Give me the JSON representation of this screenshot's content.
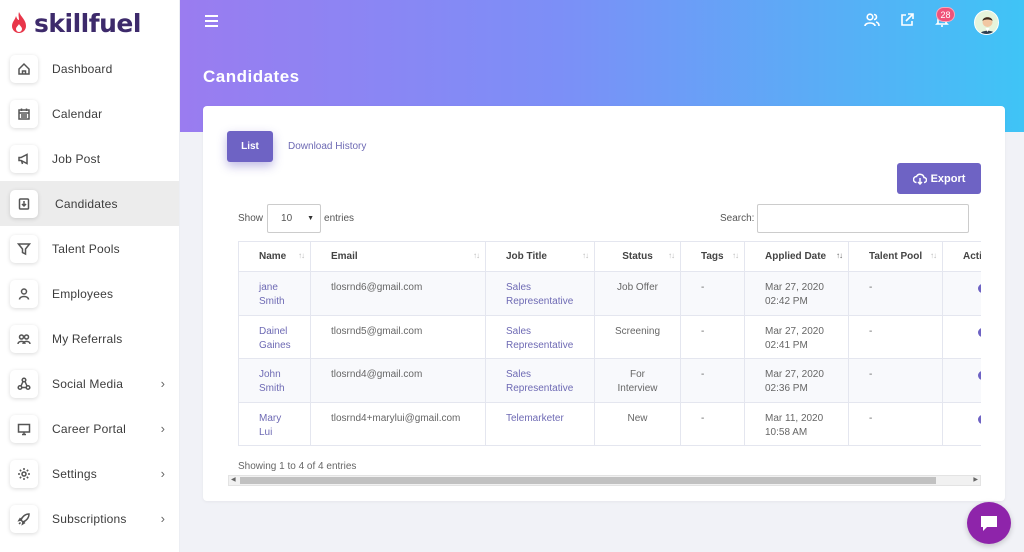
{
  "brand": {
    "name": "skillfuel"
  },
  "page": {
    "title": "Candidates"
  },
  "header": {
    "notification_count": "28"
  },
  "sidebar": {
    "items": [
      {
        "label": "Dashboard",
        "icon": "home-icon",
        "chevron": false,
        "active": false
      },
      {
        "label": "Calendar",
        "icon": "calendar-icon",
        "chevron": false,
        "active": false
      },
      {
        "label": "Job Post",
        "icon": "megaphone-icon",
        "chevron": false,
        "active": false
      },
      {
        "label": "Candidates",
        "icon": "download-box-icon",
        "chevron": false,
        "active": true
      },
      {
        "label": "Talent Pools",
        "icon": "filter-icon",
        "chevron": false,
        "active": false
      },
      {
        "label": "Employees",
        "icon": "user-icon",
        "chevron": false,
        "active": false
      },
      {
        "label": "My Referrals",
        "icon": "users-icon",
        "chevron": false,
        "active": false
      },
      {
        "label": "Social Media",
        "icon": "share-icon",
        "chevron": true,
        "active": false
      },
      {
        "label": "Career Portal",
        "icon": "monitor-icon",
        "chevron": true,
        "active": false
      },
      {
        "label": "Settings",
        "icon": "gear-icon",
        "chevron": true,
        "active": false
      },
      {
        "label": "Subscriptions",
        "icon": "rocket-icon",
        "chevron": true,
        "active": false
      }
    ]
  },
  "tabs": {
    "list": "List",
    "download_history": "Download History"
  },
  "toolbar": {
    "export_label": "Export",
    "show_label": "Show",
    "entries_value": "10",
    "entries_label": "entries",
    "search_label": "Search:",
    "search_value": ""
  },
  "table": {
    "columns": [
      "Name",
      "Email",
      "Job Title",
      "Status",
      "Tags",
      "Applied Date",
      "Talent Pool",
      "Acti"
    ],
    "rows": [
      {
        "name1": "jane",
        "name2": "Smith",
        "email": "tlosrnd6@gmail.com",
        "job1": "Sales",
        "job2": "Representative",
        "status1": "Job Offer",
        "status2": "",
        "tags": "-",
        "date1": "Mar 27, 2020",
        "date2": "02:42 PM",
        "pool": "-"
      },
      {
        "name1": "Dainel",
        "name2": "Gaines",
        "email": "tlosrnd5@gmail.com",
        "job1": "Sales",
        "job2": "Representative",
        "status1": "Screening",
        "status2": "",
        "tags": "-",
        "date1": "Mar 27, 2020",
        "date2": "02:41 PM",
        "pool": "-"
      },
      {
        "name1": "John",
        "name2": "Smith",
        "email": "tlosrnd4@gmail.com",
        "job1": "Sales",
        "job2": "Representative",
        "status1": "For",
        "status2": "Interview",
        "tags": "-",
        "date1": "Mar 27, 2020",
        "date2": "02:36 PM",
        "pool": "-"
      },
      {
        "name1": "Mary",
        "name2": "Lui",
        "email": "tlosrnd4+marylui@gmail.com",
        "job1": "Telemarketer",
        "job2": "",
        "status1": "New",
        "status2": "",
        "tags": "-",
        "date1": "Mar 11, 2020",
        "date2": "10:58 AM",
        "pool": "-"
      }
    ]
  },
  "footer": {
    "showing": "Showing 1 to 4 of 4 entries"
  },
  "colors": {
    "accent": "#6e63c4",
    "badge": "#f0527a",
    "chat": "#8e24aa"
  }
}
